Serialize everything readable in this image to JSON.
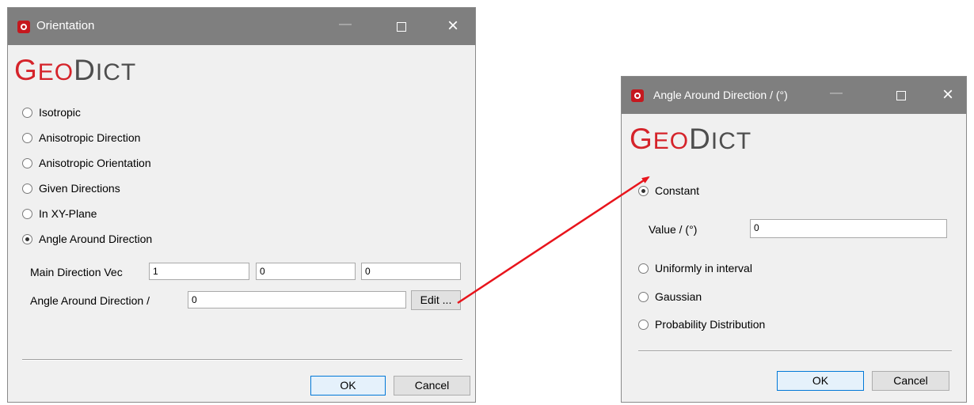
{
  "orientation_dialog": {
    "title": "Orientation",
    "logo": {
      "part1_cap": "G",
      "part1_rest": "EO",
      "part2_cap": "D",
      "part2_rest": "ICT"
    },
    "options": [
      {
        "label": "Isotropic",
        "checked": false
      },
      {
        "label": "Anisotropic Direction",
        "checked": false
      },
      {
        "label": "Anisotropic Orientation",
        "checked": false
      },
      {
        "label": "Given Directions",
        "checked": false
      },
      {
        "label": "In XY-Plane",
        "checked": false
      },
      {
        "label": "Angle Around Direction",
        "checked": true
      }
    ],
    "main_direction_label": "Main Direction Vec",
    "main_direction_values": [
      "1",
      "0",
      "0"
    ],
    "angle_label": "Angle Around Direction /",
    "angle_value": "0",
    "edit_label": "Edit ...",
    "ok_label": "OK",
    "cancel_label": "Cancel"
  },
  "angle_dialog": {
    "title": "Angle Around Direction / (°)",
    "logo": {
      "part1_cap": "G",
      "part1_rest": "EO",
      "part2_cap": "D",
      "part2_rest": "ICT"
    },
    "options": [
      {
        "label": "Constant",
        "checked": true
      },
      {
        "label": "Uniformly in interval",
        "checked": false
      },
      {
        "label": "Gaussian",
        "checked": false
      },
      {
        "label": "Probability Distribution",
        "checked": false
      }
    ],
    "value_label": "Value / (°)",
    "value": "0",
    "ok_label": "OK",
    "cancel_label": "Cancel"
  },
  "colors": {
    "brand_red": "#d5232a",
    "titlebar": "#7f7f7f",
    "arrow": "#e8141c"
  }
}
